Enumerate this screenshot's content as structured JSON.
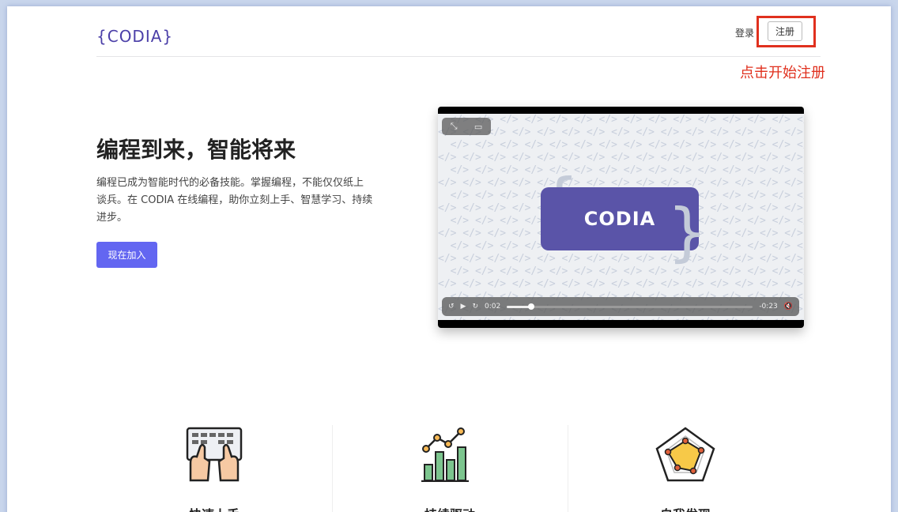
{
  "brand": {
    "logo": "{CODIA}"
  },
  "nav": {
    "login": "登录",
    "signup": "注册"
  },
  "annotation": {
    "text": "点击开始注册",
    "color": "#e0301e"
  },
  "hero": {
    "title": "编程到来，智能将来",
    "description": "编程已成为智能时代的必备技能。掌握编程，不能仅仅纸上谈兵。在 CODIA 在线编程，助你立刻上手、智慧学习、持续进步。",
    "cta": "现在加入",
    "accent": "#6366f1"
  },
  "video": {
    "logo_text": "CODIA",
    "time_elapsed": "0:02",
    "time_remaining": "-0:23",
    "progress": 0.1,
    "pattern_glyph": "</>",
    "icons": [
      "fullscreen-icon",
      "pip-icon",
      "rewind-15-icon",
      "play-icon",
      "forward-15-icon",
      "mute-icon"
    ]
  },
  "features": [
    {
      "title": "快速上手",
      "icon": "keyboard-hands-icon"
    },
    {
      "title": "持续驱动",
      "icon": "bar-chart-growth-icon"
    },
    {
      "title": "自我发现",
      "icon": "radar-chart-icon"
    }
  ]
}
